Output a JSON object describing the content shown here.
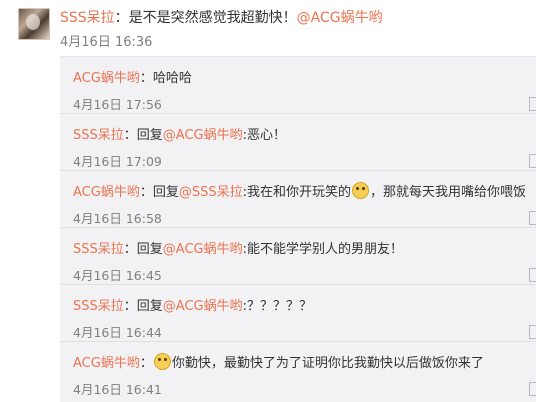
{
  "top_comment": {
    "user": "SSS呆拉",
    "colon": "：",
    "text": "是不是突然感觉我超勤快！",
    "mention": "@ACG蜗牛哟",
    "time": "4月16日 16:36"
  },
  "replies": [
    {
      "user": "ACG蜗牛哟",
      "colon": "：",
      "prefix": "",
      "mention": "",
      "text": "哈哈哈",
      "emoji": false,
      "text_after": "",
      "time": "4月16日 17:56"
    },
    {
      "user": "SSS呆拉",
      "colon": "：",
      "prefix": "回复",
      "mention": "@ACG蜗牛哟",
      "text": ":恶心！",
      "emoji": false,
      "text_after": "",
      "time": "4月16日 17:09"
    },
    {
      "user": "ACG蜗牛哟",
      "colon": "：",
      "prefix": "回复",
      "mention": "@SSS呆拉",
      "text": ":我在和你开玩笑的",
      "emoji": true,
      "emoji_icon": "doge-emoji-icon",
      "text_after": "，那就每天我用嘴给你喂饭",
      "time": "4月16日 16:58"
    },
    {
      "user": "SSS呆拉",
      "colon": "：",
      "prefix": "回复",
      "mention": "@ACG蜗牛哟",
      "text": ":能不能学学别人的男朋友！",
      "emoji": false,
      "text_after": "",
      "time": "4月16日 16:45"
    },
    {
      "user": "SSS呆拉",
      "colon": "：",
      "prefix": "回复",
      "mention": "@ACG蜗牛哟",
      "text": ":？？？？？",
      "emoji": false,
      "text_after": "",
      "time": "4月16日 16:44"
    },
    {
      "user": "ACG蜗牛哟",
      "colon": "：",
      "prefix": "",
      "mention": "",
      "text": "",
      "emoji": true,
      "emoji_icon": "doge-emoji-icon",
      "text_after": "你勤快，最勤快了为了证明你比我勤快以后做饭你来了",
      "time": "4月16日 16:41"
    }
  ],
  "colors": {
    "username": "#eb7350",
    "text": "#333333",
    "time": "#808080",
    "reply_background": "#f2f2f5"
  }
}
